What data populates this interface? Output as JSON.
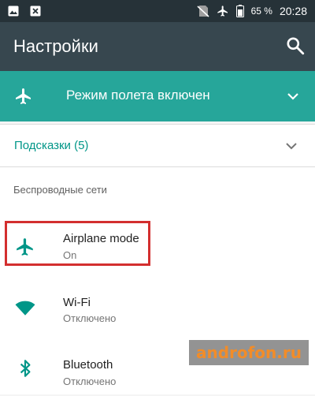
{
  "status_bar": {
    "notification_icons": [
      "image-icon",
      "close-box-icon"
    ],
    "status_icons": [
      "no-sim-icon",
      "airplane-icon",
      "battery-icon"
    ],
    "battery_percent": "65 %",
    "time": "20:28"
  },
  "toolbar": {
    "title": "Настройки",
    "search_icon": "search-icon"
  },
  "airplane_banner": {
    "text": "Режим полета включен",
    "icon": "airplane-icon",
    "expand_icon": "chevron-down-icon"
  },
  "suggestions": {
    "label": "Подсказки (5)",
    "expand_icon": "chevron-down-icon"
  },
  "wireless_section": {
    "header": "Беспроводные сети",
    "items": [
      {
        "title": "Airplane mode",
        "summary": "On",
        "icon": "airplane-icon",
        "highlighted": true
      },
      {
        "title": "Wi-Fi",
        "summary": "Отключено",
        "icon": "wifi-icon",
        "highlighted": false
      },
      {
        "title": "Bluetooth",
        "summary": "Отключено",
        "icon": "bluetooth-icon",
        "highlighted": false
      }
    ]
  },
  "watermark": "androfon.ru",
  "colors": {
    "status_bar": "#263238",
    "toolbar": "#37474f",
    "accent": "#26a69a",
    "accent_text": "#009688",
    "highlight": "#d32f2f",
    "watermark_text": "#f28c28"
  }
}
